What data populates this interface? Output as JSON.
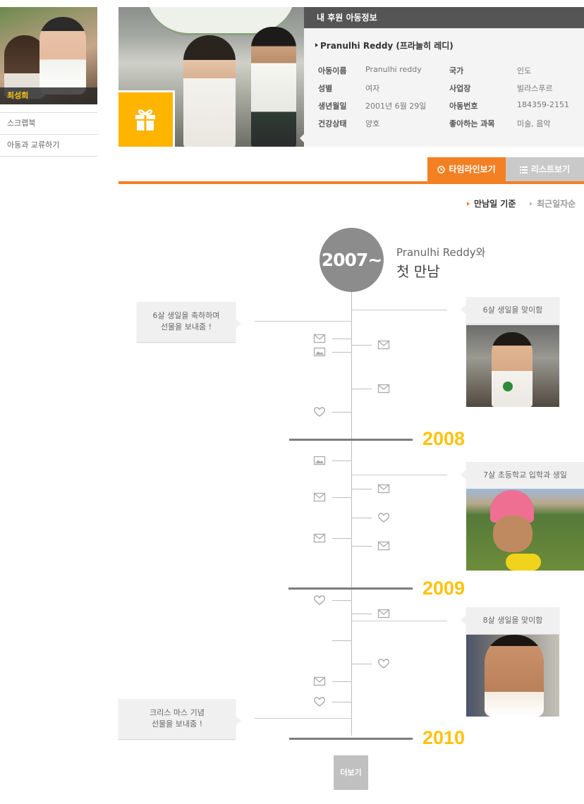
{
  "sidebar": {
    "profile_name": "최성희",
    "menu": [
      "스크랩북",
      "아동과 교류하기"
    ]
  },
  "info": {
    "header": "내 후원 아동정보",
    "child_name": "Pranulhi Reddy (프라눌히 레디)",
    "fields": [
      {
        "label": "아동이름",
        "value": "Pranulhi reddy"
      },
      {
        "label": "국가",
        "value": "인도"
      },
      {
        "label": "성별",
        "value": "여자"
      },
      {
        "label": "사업장",
        "value": "빌라스푸르"
      },
      {
        "label": "생년월일",
        "value": "2001년 6월 29일"
      },
      {
        "label": "아동번호",
        "value": "184359-2151"
      },
      {
        "label": "건강상태",
        "value": "양호"
      },
      {
        "label": "좋아하는 과목",
        "value": "미술, 음악"
      }
    ]
  },
  "tabs": {
    "timeline": "타임라인보기",
    "list": "리스트보기"
  },
  "sort": {
    "first_meet": "만남일 기준",
    "recent": "최근일자순"
  },
  "timeline": {
    "start_year": "2007~",
    "first_meet_line1": "Pranulhi Reddy와",
    "first_meet_line2": "첫 만남",
    "years": [
      "2008",
      "2009",
      "2010"
    ],
    "events": [
      {
        "text_line1": "6살 생일을 축하하며",
        "text_line2": "선물을 보내줌 !"
      },
      {
        "text_line1": "6살 생일을 맞이함"
      },
      {
        "text_line1": "7살 초등학교 입학과 생일"
      },
      {
        "text_line1": "8살 생일을 맞이함"
      },
      {
        "text_line1": "크리스 마스 기념",
        "text_line2": "선물을 보내줌 !"
      }
    ],
    "icons": {
      "mail": "mail-icon",
      "photo": "photo-icon",
      "heart": "heart-icon"
    }
  },
  "more_button": "더보기",
  "colors": {
    "accent_orange": "#f48024",
    "year_yellow": "#ffc20e",
    "gift_yellow": "#ffb400",
    "header_dark": "#555555"
  }
}
